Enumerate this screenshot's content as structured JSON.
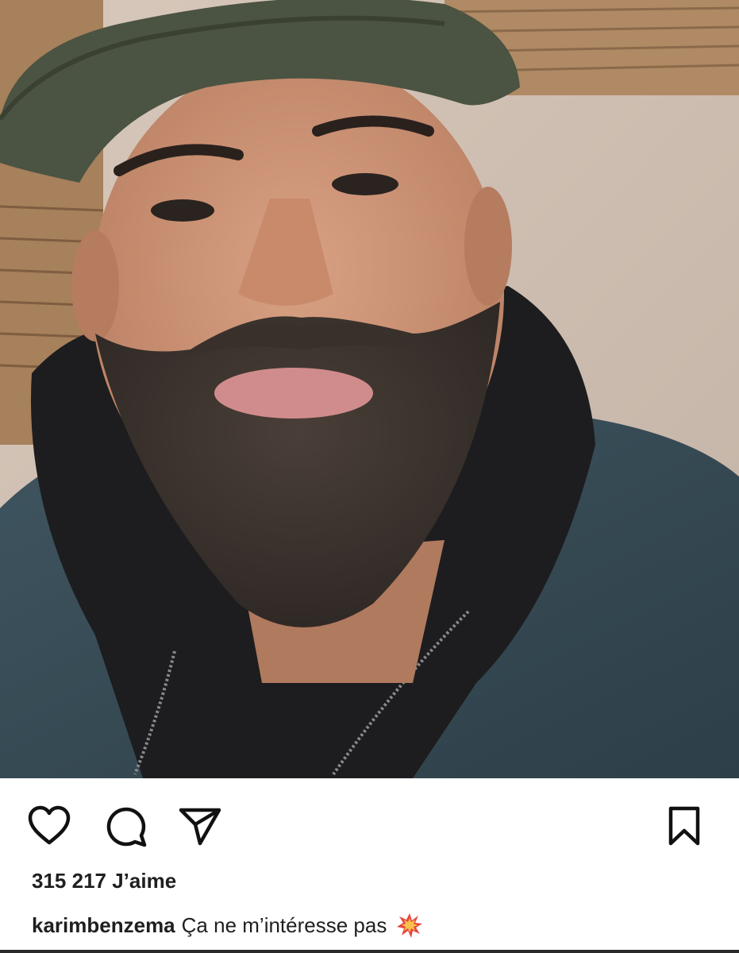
{
  "post": {
    "photo_icon": "selfie-photo",
    "likes": "315 217 J’aime",
    "username": "karimbenzema",
    "caption": "Ça ne m’intéresse pas",
    "caption_emoji": "collision-emoji"
  },
  "actions": {
    "like_icon": "heart-icon",
    "comment_icon": "comment-icon",
    "share_icon": "send-icon",
    "save_icon": "bookmark-icon"
  },
  "colors": {
    "text": "#1f1f1f",
    "background": "#ffffff"
  }
}
